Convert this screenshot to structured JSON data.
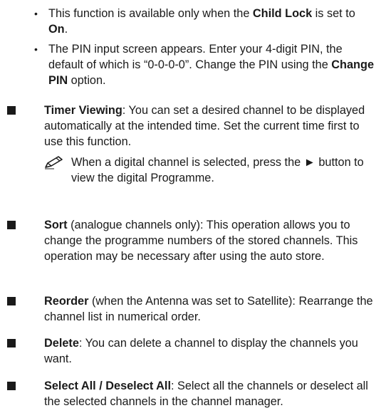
{
  "sub_bullets": [
    {
      "pre": "This function is available only when the ",
      "b1": "Child Lock",
      "mid": " is set to ",
      "b2": "On",
      "post": "."
    },
    {
      "pre": "The PIN input screen appears. Enter your 4-digit PIN, the default of which is “0-0-0-0”. Change the PIN using the ",
      "b1": "Change PIN",
      "post": " option."
    }
  ],
  "items": [
    {
      "title": "Timer Viewing",
      "text": ": You can set a desired channel to be displayed automatically at the intended time. Set the current time first to use this function.",
      "note": "When a digital channel is selected, press the ► button to view the digital Programme."
    },
    {
      "title": "Sort",
      "text": " (analogue channels only): This operation allows you to change the programme numbers of the stored channels. This operation may be necessary after using the auto store."
    },
    {
      "title": "Reorder",
      "text": " (when the Antenna was set to Satellite): Rearrange the channel list in numerical order."
    },
    {
      "title": "Delete",
      "text": ": You can delete a channel to display the channels you want."
    },
    {
      "title": "Select All / Deselect All",
      "text": ": Select all the channels or deselect all the selected channels in the channel manager."
    }
  ]
}
